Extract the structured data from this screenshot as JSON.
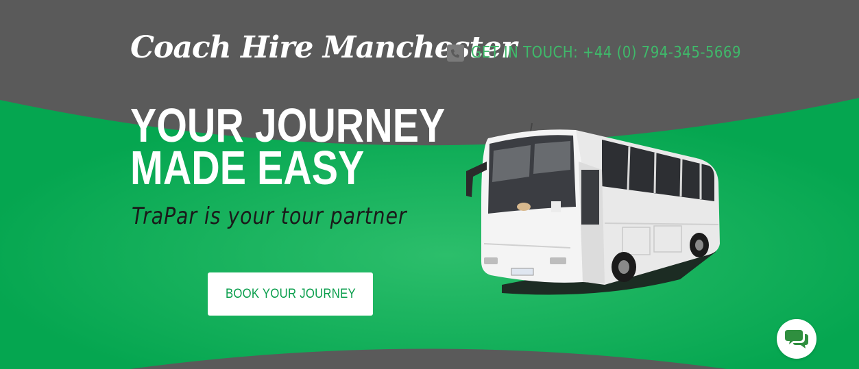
{
  "header": {
    "brand": "Coach Hire Manchester",
    "contact": "GET IN TOUCH: +44 (0) 794-345-5669",
    "contact_icon": "phone-square-icon"
  },
  "hero": {
    "headline_line1": "YOUR JOURNEY",
    "headline_line2": "MADE EASY",
    "tagline": "TraPar is your tour partner",
    "cta_label": "BOOK YOUR JOURNEY",
    "image": "white-coach-bus"
  },
  "chat": {
    "icon": "chat-bubbles-icon"
  },
  "colors": {
    "background_dark": "#5a5a5a",
    "accent_green": "#0fa84f",
    "contact_green": "#3fb96a",
    "cta_text": "#0a9e4c",
    "chat_icon": "#2f8f3f"
  }
}
